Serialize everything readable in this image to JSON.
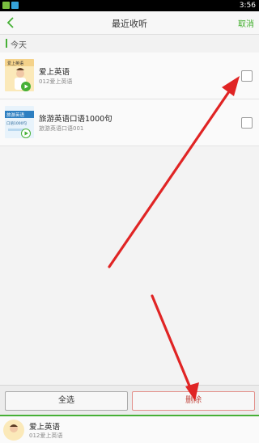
{
  "status_bar": {
    "time": "3:56"
  },
  "header": {
    "title": "最近收听",
    "cancel_label": "取消"
  },
  "section": {
    "label": "今天"
  },
  "items": [
    {
      "title": "爱上英语",
      "subtitle": "012爱上英语",
      "thumb_text": "爱上英语"
    },
    {
      "title": "旅游英语口语1000句",
      "subtitle": "旅游英语口语001",
      "thumb_text": "旅游英语",
      "thumb_subtext": "口语1000句"
    }
  ],
  "footer": {
    "select_all_label": "全选",
    "delete_label": "删除"
  },
  "player": {
    "title": "爱上英语",
    "subtitle": "012爱上英语"
  },
  "colors": {
    "accent": "#46b036",
    "annotation": "#e02424"
  }
}
